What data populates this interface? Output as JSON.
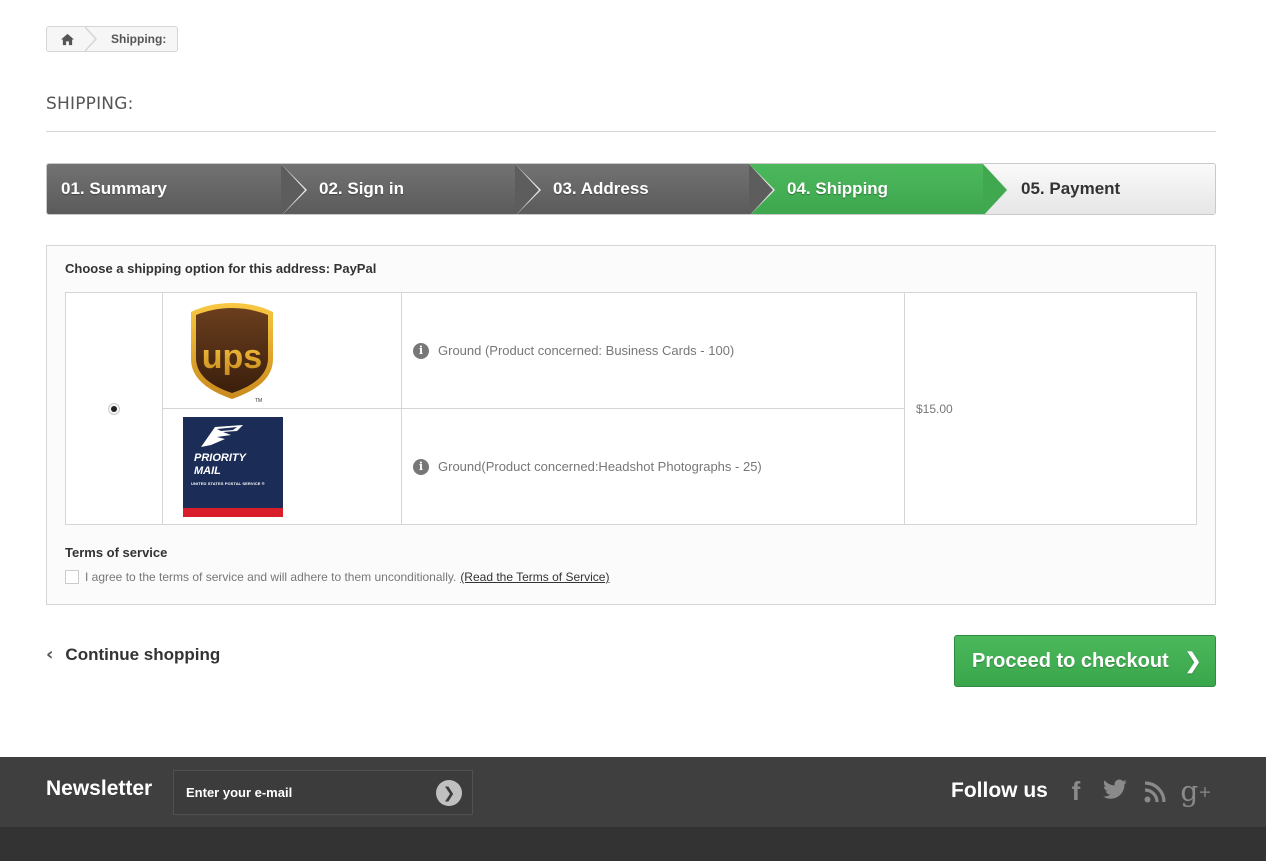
{
  "breadcrumb": {
    "current": "Shipping:"
  },
  "page": {
    "title": "SHIPPING:"
  },
  "steps": [
    {
      "label": "01. Summary",
      "state": "done"
    },
    {
      "label": "02. Sign in",
      "state": "done"
    },
    {
      "label": "03. Address",
      "state": "done"
    },
    {
      "label": "04. Shipping",
      "state": "current"
    },
    {
      "label": "05. Payment",
      "state": "todo"
    }
  ],
  "shipping": {
    "heading": "Choose a shipping option for this address: PayPal",
    "rows": [
      {
        "carrier": "UPS",
        "description": "Ground (Product concerned: Business Cards - 100)"
      },
      {
        "carrier": "USPS Priority Mail",
        "description": "Ground(Product concerned:Headshot Photographs - 25)"
      }
    ],
    "price": "$15.00",
    "usps_logo": {
      "line1": "PRIORITY",
      "line2": "MAIL",
      "line3": "UNITED STATES POSTAL SERVICE ®"
    },
    "ups_logo": {
      "text": "ups",
      "tm": "TM"
    }
  },
  "terms": {
    "title": "Terms of service",
    "agree_text": "I agree to the terms of service and will adhere to them unconditionally.",
    "link_text": "(Read the Terms of Service)"
  },
  "actions": {
    "continue_label": "Continue shopping",
    "checkout_label": "Proceed to checkout"
  },
  "footer": {
    "newsletter_label": "Newsletter",
    "newsletter_placeholder": "Enter your e-mail",
    "follow_label": "Follow us"
  },
  "colors": {
    "accent_green": "#46b358",
    "step_done": "#666666",
    "footer_bg": "#3f3f3f"
  }
}
